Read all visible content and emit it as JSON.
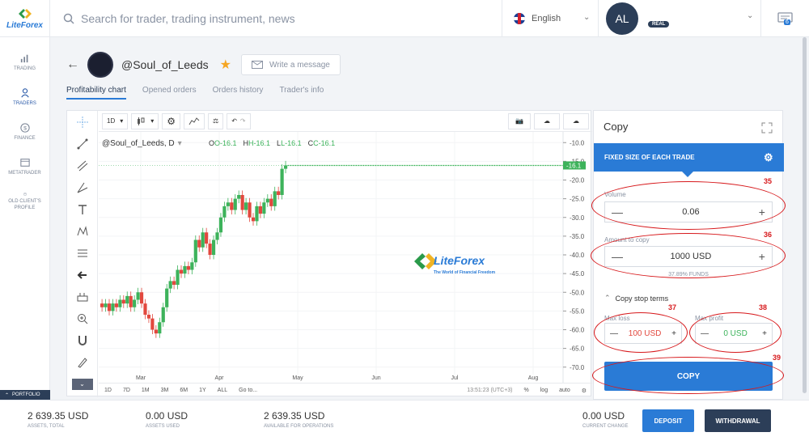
{
  "brand": {
    "name": "LiteForex",
    "tagline": "The World of Financial Freedom"
  },
  "search": {
    "placeholder": "Search for trader, trading instrument, news"
  },
  "language": {
    "label": "English"
  },
  "account": {
    "initials": "AL",
    "badge": "REAL"
  },
  "notifications": {
    "count": "6"
  },
  "sidebar": {
    "items": [
      {
        "label": "TRADING",
        "icon": "bar-chart-icon"
      },
      {
        "label": "TRADERS",
        "icon": "person-icon"
      },
      {
        "label": "FINANCE",
        "icon": "dollar-icon"
      },
      {
        "label": "METATRADER",
        "icon": "window-icon"
      },
      {
        "label": "OLD CLIENT'S PROFILE",
        "icon": "refresh-icon"
      }
    ],
    "portfolio": "PORTFOLIO"
  },
  "trader": {
    "name": "@Soul_of_Leeds",
    "message_button": "Write a message"
  },
  "tabs": [
    "Profitability chart",
    "Opened orders",
    "Orders history",
    "Trader's info"
  ],
  "chart_toolbar": {
    "interval": "1D"
  },
  "chart_data": {
    "type": "candlestick",
    "symbol": "@Soul_of_Leeds, D",
    "ohlc": {
      "o": "O-16.1",
      "h": "H-16.1",
      "l": "L-16.1",
      "c": "C-16.1"
    },
    "last_value": "-16.1",
    "x_tick_labels": [
      "Mar",
      "Apr",
      "May",
      "Jun",
      "Jul",
      "Aug"
    ],
    "y_tick_labels": [
      "-10.0",
      "-15.0",
      "-20.0",
      "-25.0",
      "-30.0",
      "-35.0",
      "-40.0",
      "-45.0",
      "-50.0",
      "-55.0",
      "-60.0",
      "-65.0",
      "-70.0"
    ],
    "ylim": [
      -72,
      -8
    ],
    "closes": [
      -54,
      -53,
      -55,
      -53,
      -54,
      -52,
      -53,
      -51,
      -54,
      -52,
      -50,
      -53,
      -56,
      -57,
      -60,
      -61,
      -58,
      -54,
      -49,
      -47,
      -48,
      -44,
      -45,
      -43,
      -44,
      -42,
      -36,
      -38,
      -34,
      -37,
      -40,
      -36,
      -34,
      -30,
      -27,
      -26,
      -28,
      -25,
      -24,
      -28,
      -26,
      -30,
      -31,
      -27,
      -29,
      -26,
      -25,
      -27,
      -23,
      -24,
      -17,
      -16.1
    ],
    "flat_from_index": 52,
    "flat_value": -16.1
  },
  "chart_bottom": {
    "ranges": [
      "1D",
      "7D",
      "1M",
      "3M",
      "6M",
      "1Y",
      "ALL"
    ],
    "goto": "Go to...",
    "time": "13:51:23 (UTC+3)",
    "percent": "%",
    "log": "log",
    "auto": "auto"
  },
  "copy_panel": {
    "title": "Copy",
    "mode": "FIXED SIZE OF EACH TRADE",
    "volume": {
      "label": "Volume",
      "value": "0.06"
    },
    "amount": {
      "label": "Amount to copy",
      "value": "1000 USD",
      "funds": "37.89% FUNDS"
    },
    "stop_terms": "Copy stop terms",
    "max_loss": {
      "label": "Max loss",
      "value": "100 USD",
      "color": "#e2483e"
    },
    "max_profit": {
      "label": "Max profit",
      "value": "0 USD",
      "color": "#3db35b"
    },
    "button": "COPY"
  },
  "annotations": [
    "35",
    "36",
    "37",
    "38",
    "39"
  ],
  "footer": {
    "assets_total": {
      "value": "2 639.35 USD",
      "label": "ASSETS, TOTAL"
    },
    "assets_used": {
      "value": "0.00 USD",
      "label": "ASSETS USED"
    },
    "available": {
      "value": "2 639.35 USD",
      "label": "AVAILABLE FOR OPERATIONS"
    },
    "current_change": {
      "value": "0.00 USD",
      "label": "CURRENT CHANGE"
    },
    "deposit": "DEPOSIT",
    "withdrawal": "WITHDRAWAL"
  }
}
